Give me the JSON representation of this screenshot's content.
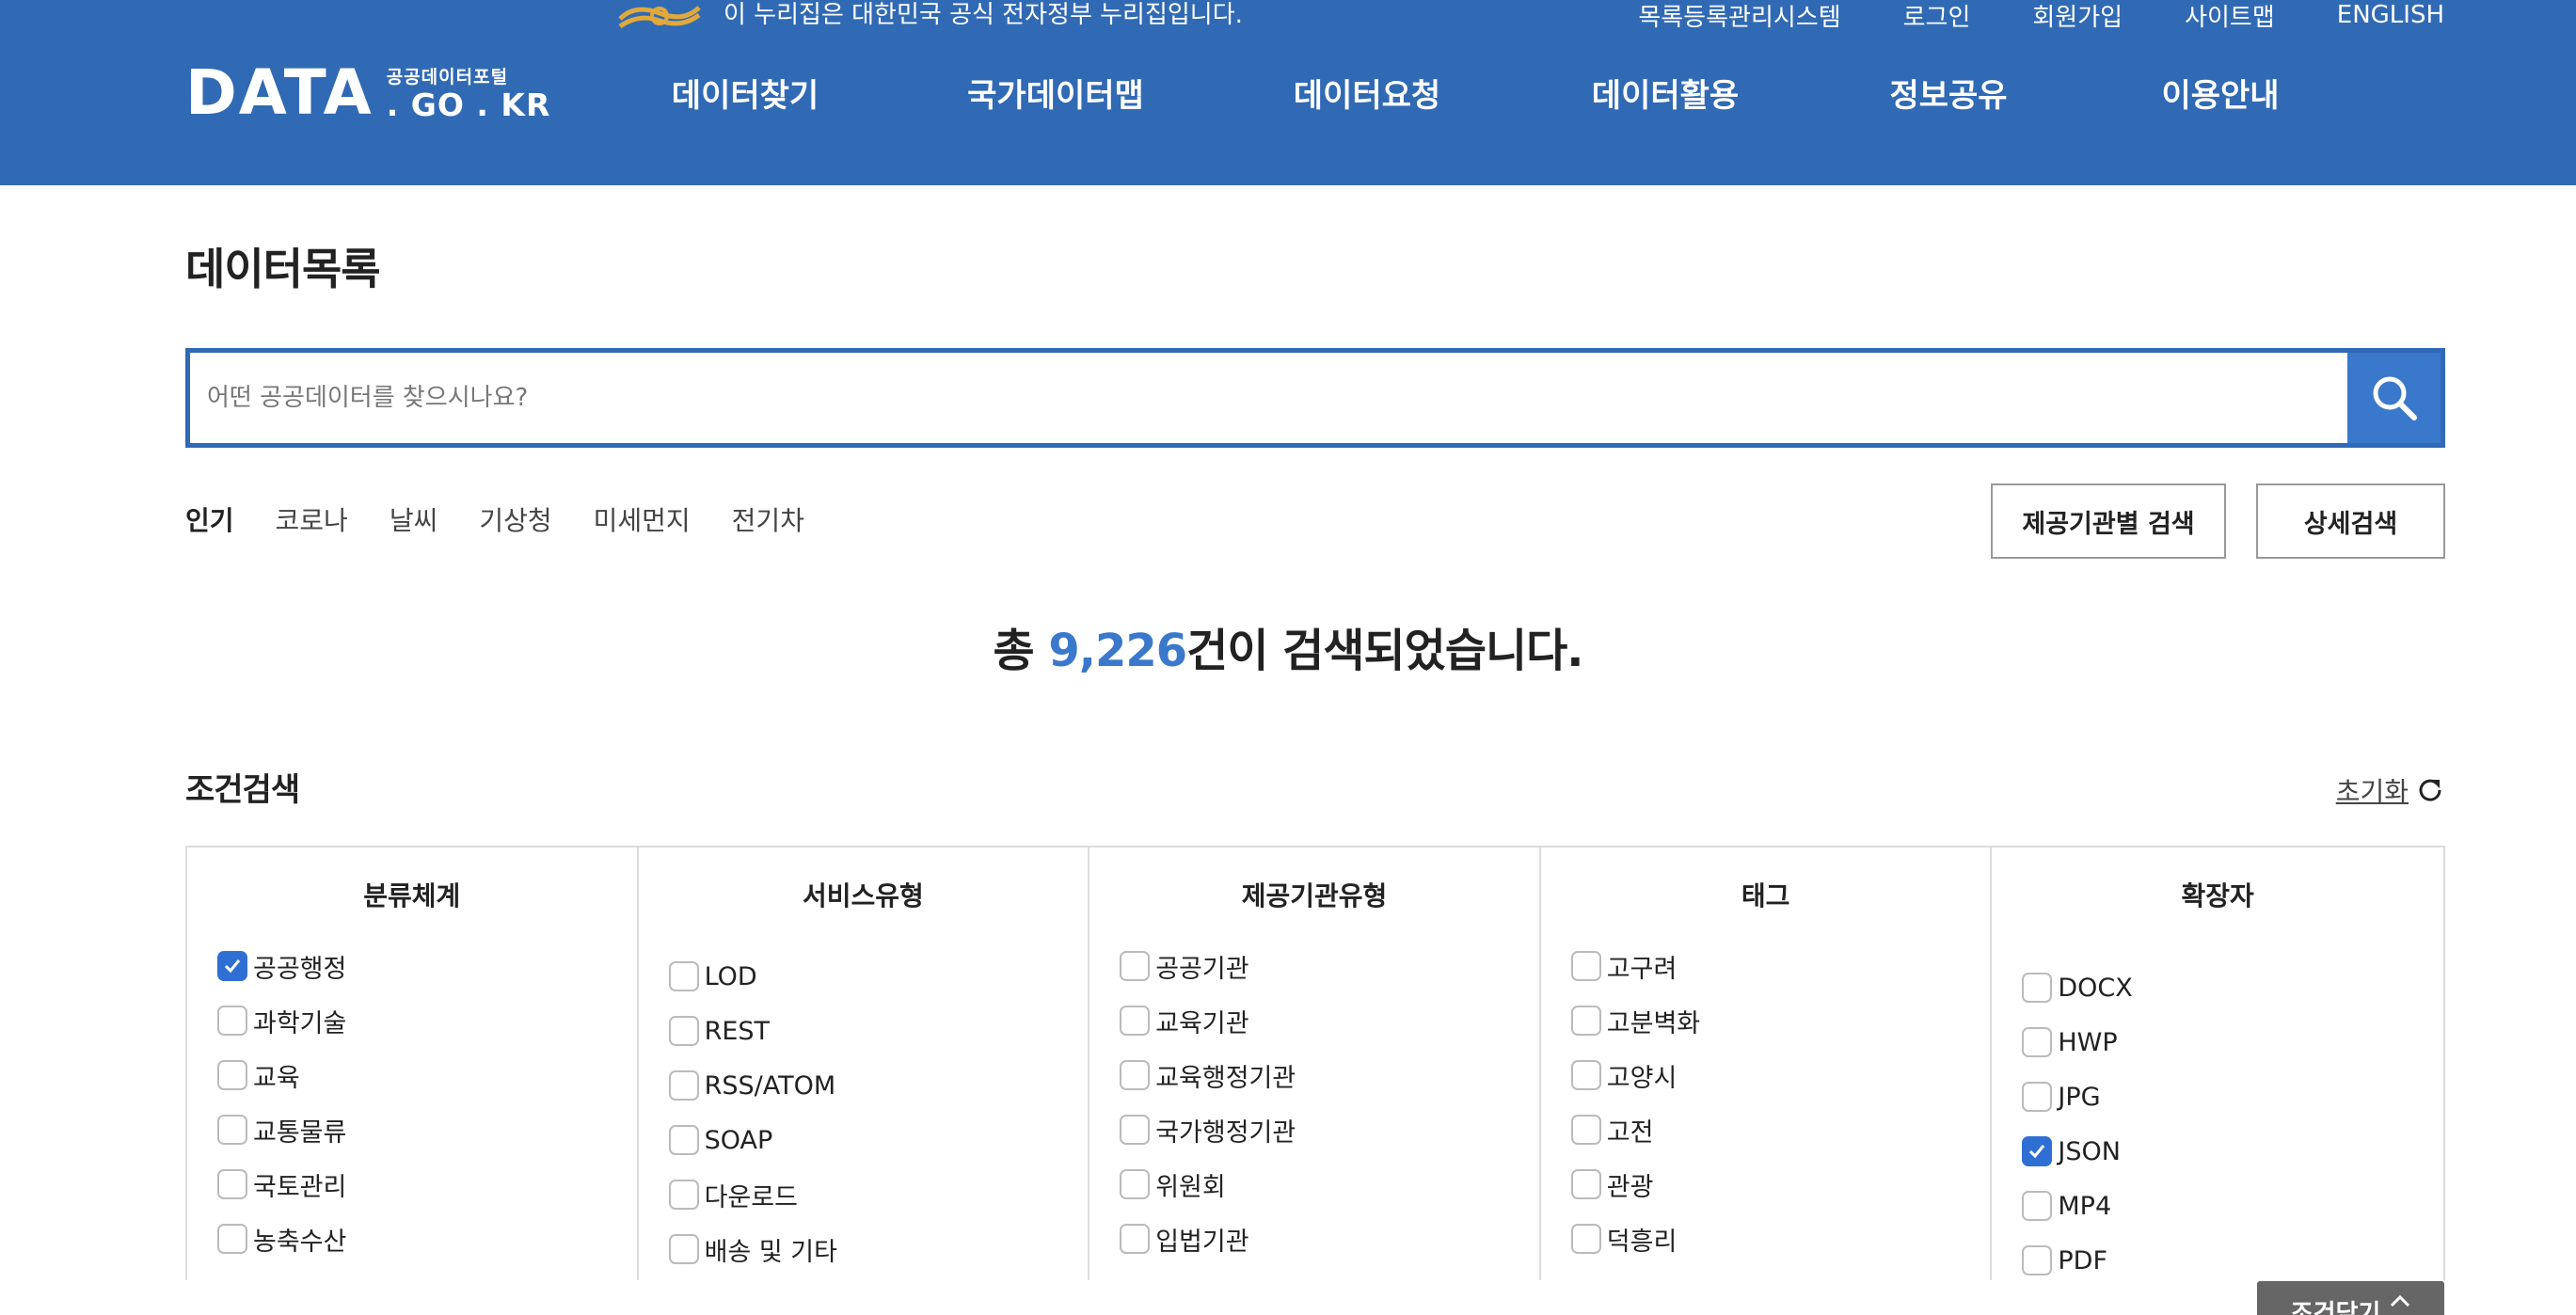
{
  "header": {
    "gov_notice": "이 누리집은 대한민국 공식 전자정부 누리집입니다.",
    "util_menu": [
      "목록등록관리시스템",
      "로그인",
      "회원가입",
      "사이트맵",
      "ENGLISH"
    ],
    "logo": {
      "main": "DATA",
      "kr": "공공데이터포털",
      "domain": ". GO . KR"
    },
    "gnb": [
      "데이터찾기",
      "국가데이터맵",
      "데이터요청",
      "데이터활용",
      "정보공유",
      "이용안내"
    ],
    "color": "#316ab4"
  },
  "page_title": "데이터목록",
  "search": {
    "placeholder": "어떤 공공데이터를 찾으시나요?",
    "value": ""
  },
  "popular": {
    "label": "인기",
    "keywords": [
      "코로나",
      "날씨",
      "기상청",
      "미세먼지",
      "전기차"
    ]
  },
  "buttons": {
    "org_search": "제공기관별 검색",
    "detail_search": "상세검색",
    "collapse": "조건닫기"
  },
  "result": {
    "prefix": "총 ",
    "count": "9,226",
    "suffix": "건이 검색되었습니다."
  },
  "filter": {
    "title": "조건검색",
    "reset": "초기화",
    "columns": [
      {
        "header": "분류체계",
        "items": [
          {
            "label": "공공행정",
            "checked": true
          },
          {
            "label": "과학기술",
            "checked": false
          },
          {
            "label": "교육",
            "checked": false
          },
          {
            "label": "교통물류",
            "checked": false
          },
          {
            "label": "국토관리",
            "checked": false
          },
          {
            "label": "농축수산",
            "checked": false
          }
        ]
      },
      {
        "header": "서비스유형",
        "items": [
          {
            "label": "LOD",
            "checked": false
          },
          {
            "label": "REST",
            "checked": false
          },
          {
            "label": "RSS/ATOM",
            "checked": false
          },
          {
            "label": "SOAP",
            "checked": false
          },
          {
            "label": "다운로드",
            "checked": false
          },
          {
            "label": "배송 및 기타",
            "checked": false
          }
        ]
      },
      {
        "header": "제공기관유형",
        "items": [
          {
            "label": "공공기관",
            "checked": false
          },
          {
            "label": "교육기관",
            "checked": false
          },
          {
            "label": "교육행정기관",
            "checked": false
          },
          {
            "label": "국가행정기관",
            "checked": false
          },
          {
            "label": "위원회",
            "checked": false
          },
          {
            "label": "입법기관",
            "checked": false
          }
        ]
      },
      {
        "header": "태그",
        "items": [
          {
            "label": "고구려",
            "checked": false
          },
          {
            "label": "고분벽화",
            "checked": false
          },
          {
            "label": "고양시",
            "checked": false
          },
          {
            "label": "고전",
            "checked": false
          },
          {
            "label": "관광",
            "checked": false
          },
          {
            "label": "덕흥리",
            "checked": false
          }
        ]
      },
      {
        "header": "확장자",
        "items": [
          {
            "label": "DOCX",
            "checked": false
          },
          {
            "label": "HWP",
            "checked": false
          },
          {
            "label": "JPG",
            "checked": false
          },
          {
            "label": "JSON",
            "checked": true
          },
          {
            "label": "MP4",
            "checked": false
          },
          {
            "label": "PDF",
            "checked": false
          }
        ]
      }
    ]
  }
}
